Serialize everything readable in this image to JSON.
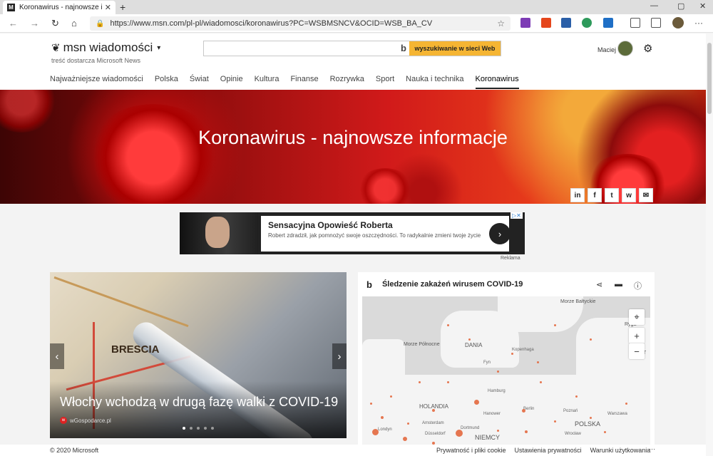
{
  "browser": {
    "tab_title": "Koronawirus - najnowsze inform",
    "tab_close": "✕",
    "new_tab": "+",
    "url": "https://www.msn.com/pl-pl/wiadomosci/koronawirus?PC=WSBMSNCV&OCID=WSB_BA_CV",
    "win_minimize": "—",
    "win_maximize": "▢",
    "win_close": "✕",
    "back": "←",
    "forward": "→",
    "refresh": "↻",
    "home": "⌂",
    "more": "···",
    "lock": "🔒",
    "star": "☆"
  },
  "header": {
    "logo_text": "msn wiadomości",
    "logo_sub": "treść dostarcza Microsoft News",
    "search_placeholder": "",
    "search_button": "wyszukiwanie w sieci Web",
    "user_name": "Maciej"
  },
  "nav": {
    "items": [
      "Najważniejsze wiadomości",
      "Polska",
      "Świat",
      "Opinie",
      "Kultura",
      "Finanse",
      "Rozrywka",
      "Sport",
      "Nauka i technika",
      "Koronawirus"
    ],
    "active": "Koronawirus"
  },
  "hero": {
    "title": "Koronawirus - najnowsze informacje",
    "share": [
      "in",
      "f",
      "t",
      "w",
      "✉"
    ]
  },
  "ad": {
    "title": "Sensacyjna Opowieść Roberta",
    "desc": "Robert zdradził, jak pomnożyć swoje oszczędności. To radykalnie zmieni twoje życie",
    "label": "Reklama",
    "go": "›"
  },
  "story": {
    "headline": "Włochy wchodzą w drugą fazę walki z COVID-19",
    "source": "wGospodarce.pl",
    "city": "BRESCIA",
    "dots": 5,
    "active_dot": 0
  },
  "tracker": {
    "title": "Śledzenie zakażeń wirusem COVID-19",
    "map_labels": {
      "sea_north": "Morze Północne",
      "sea_baltic": "Morze Bałtyckie",
      "denmark": "DANIA",
      "netherlands": "HOLANDIA",
      "germany": "NIEMCY",
      "poland": "POLSKA",
      "rygia": "Ryga",
      "lithuania": "LIT"
    },
    "cities": [
      "Kopenhaga",
      "Fyn",
      "Hamburg",
      "Hanower",
      "Berlin",
      "Poznań",
      "Warszawa",
      "Wrocław",
      "Amsterdam",
      "Dortmund",
      "Düsseldorf",
      "Londyn"
    ]
  },
  "footer": {
    "copyright": "© 2020 Microsoft",
    "links": [
      "Prywatność i pliki cookie",
      "Ustawienia prywatności",
      "Warunki użytkowania"
    ],
    "more": "···"
  },
  "colors": {
    "search_button": "#f5b533",
    "hero_red": "#d11a1a",
    "map_dot": "#e3683e"
  }
}
